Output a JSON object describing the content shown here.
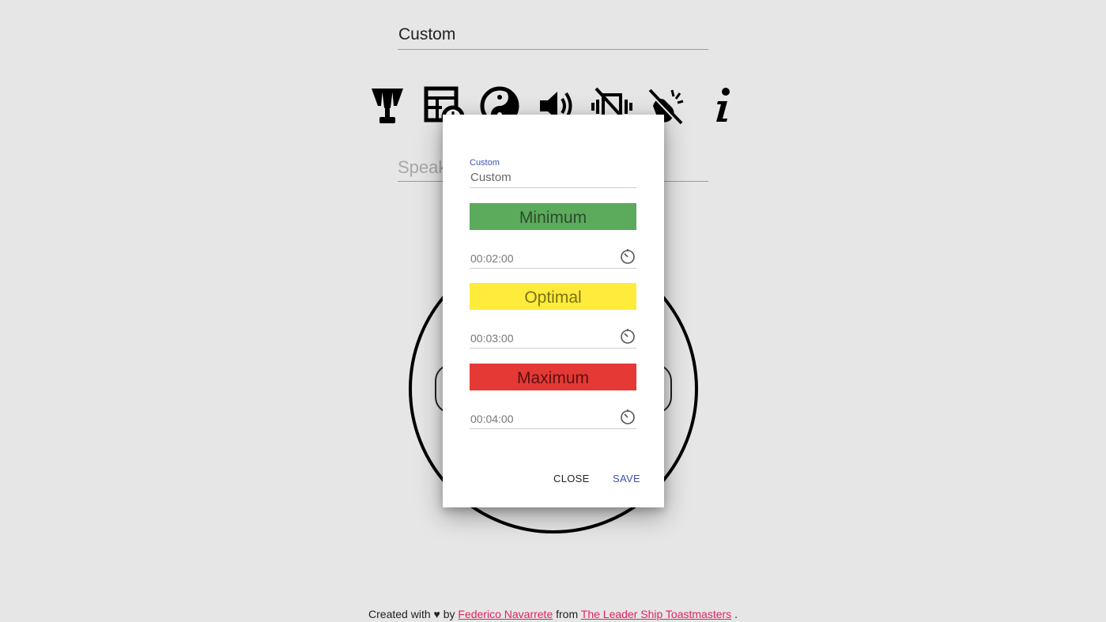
{
  "header": {
    "title_value": "Custom"
  },
  "toolbar": {
    "items": [
      {
        "icon": "trophy-icon"
      },
      {
        "icon": "schedule-table-icon"
      },
      {
        "icon": "yin-yang-icon"
      },
      {
        "icon": "volume-icon"
      },
      {
        "icon": "vibration-off-icon"
      },
      {
        "icon": "clap-off-icon"
      },
      {
        "icon": "info-icon"
      }
    ]
  },
  "speaker": {
    "placeholder": "Speak"
  },
  "dialog": {
    "name_label": "Custom",
    "name_value": "Custom",
    "minimum": {
      "label": "Minimum",
      "value": "00:02:00",
      "color": "#5caa5c"
    },
    "optimal": {
      "label": "Optimal",
      "value": "00:03:00",
      "color": "#ffeb3b"
    },
    "maximum": {
      "label": "Maximum",
      "value": "00:04:00",
      "color": "#e53935"
    },
    "close_label": "CLOSE",
    "save_label": "SAVE"
  },
  "footer": {
    "prefix": "Created with ♥ by",
    "author": "Federico Navarrete",
    "middle": "from",
    "club": "The Leader Ship Toastmasters",
    "suffix": "."
  }
}
